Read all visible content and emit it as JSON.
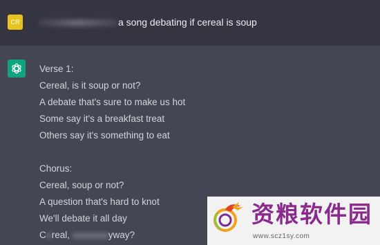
{
  "user_message": {
    "avatar_initials": "CR",
    "text": "a song debating if cereal is soup"
  },
  "assistant_message": {
    "icon": "chatgpt-logo-icon",
    "verse_lines": [
      "Verse 1:",
      "Cereal, is it soup or not?",
      "A debate that's sure to make us hot",
      "Some say it's a breakfast treat",
      "Others say it's something to eat"
    ],
    "chorus_lines": [
      "Chorus:",
      "Cereal, soup or not?",
      "A question that's hard to knot",
      "We'll debate it all day"
    ],
    "last_line_start": "C",
    "last_line_mid": "real,",
    "last_line_end": "yway?"
  },
  "watermark": {
    "title": "资粮软件园",
    "url": "www.scz1sy.com"
  },
  "colors": {
    "user_bg": "#343541",
    "assistant_bg": "#444654",
    "user_avatar": "#e6c320",
    "assistant_avatar": "#10a37f",
    "watermark_text": "#8a2a8c"
  }
}
